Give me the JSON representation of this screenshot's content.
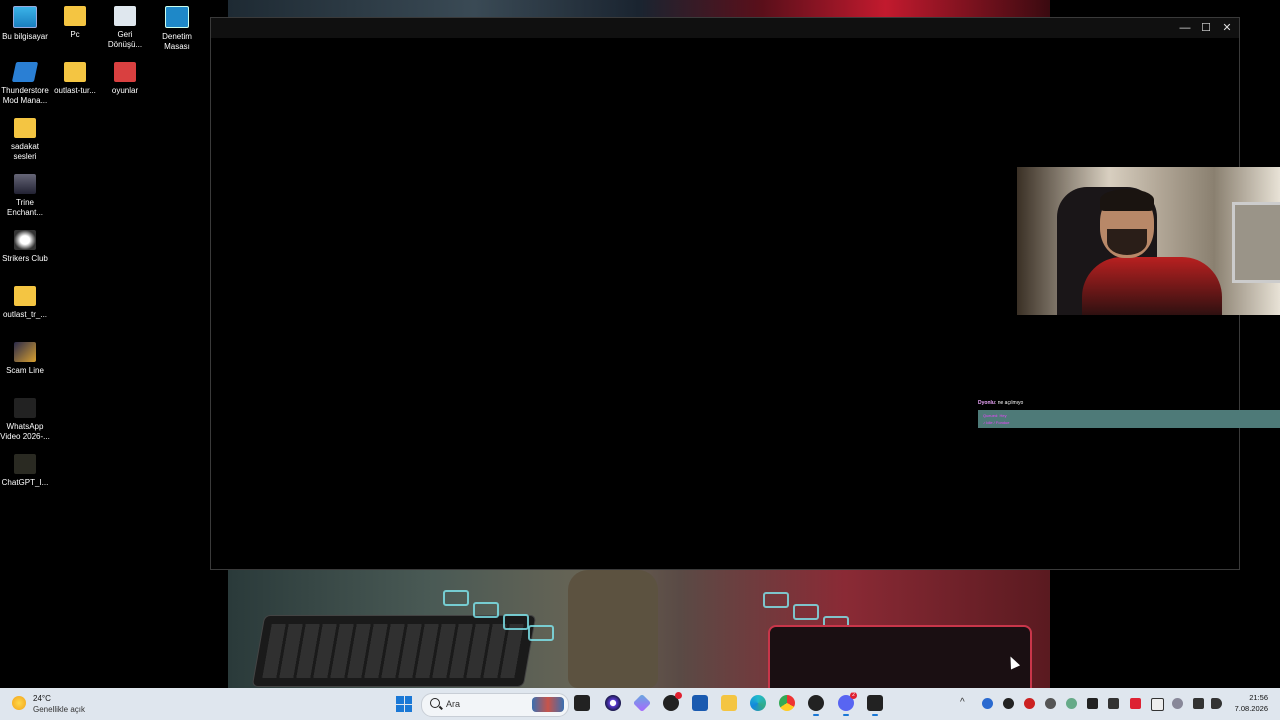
{
  "desktop_icons": [
    {
      "label": "Bu bilgisayar",
      "icon": "monitor-icon"
    },
    {
      "label": "Pc",
      "icon": "folder-icon"
    },
    {
      "label": "Geri Dönüşü...",
      "icon": "recycle-bin-icon"
    },
    {
      "label": "Denetim Masası",
      "icon": "control-panel-icon"
    },
    {
      "label": "Thunderstore Mod Mana...",
      "icon": "thunderstore-icon"
    },
    {
      "label": "outlast-tur...",
      "icon": "folder-icon"
    },
    {
      "label": "oyunlar",
      "icon": "power-app-icon"
    },
    {
      "label": "sadakat sesleri",
      "icon": "folder-icon"
    },
    {
      "label": "Trine Enchant...",
      "icon": "trine-game-icon"
    },
    {
      "label": "Strikers Club",
      "icon": "strikers-club-icon"
    },
    {
      "label": "outlast_tr_...",
      "icon": "folder-icon"
    },
    {
      "label": "Scam Line",
      "icon": "scam-line-icon"
    },
    {
      "label": "WhatsApp Video 2026-...",
      "icon": "video-file-icon"
    },
    {
      "label": "ChatGPT_I...",
      "icon": "image-file-icon"
    }
  ],
  "window": {
    "minimize": "—",
    "maximize": "☐",
    "close": "✕"
  },
  "chat": {
    "user": "Dyonlu",
    "message": ": ne açılmıyo",
    "box_line1": "Queued: Hey",
    "box_line2": "♪ Idle / Fondue"
  },
  "taskbar": {
    "weather_temp": "24°C",
    "weather_desc": "Genellikle açık",
    "search_placeholder": "Ara",
    "time": "21:56",
    "date": "7.08.2026",
    "discord_badge": "2"
  },
  "colors": {
    "accent": "#1a78d6",
    "taskbar_bg": "#dfe6ee",
    "chat_box": "#4e7a78"
  }
}
